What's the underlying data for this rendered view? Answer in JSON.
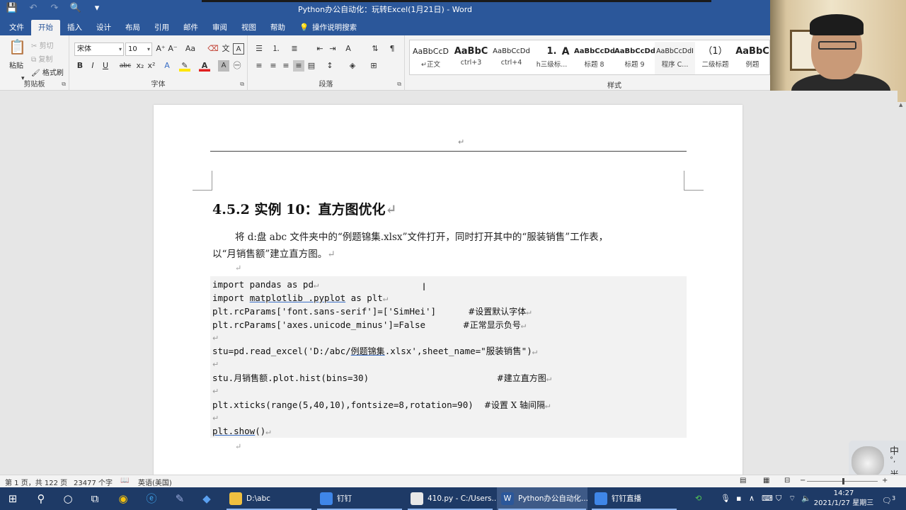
{
  "window": {
    "title": "Python办公自动化：玩转Excel(1月21日)  -  Word",
    "qat": [
      "💾",
      "↶",
      "↷",
      "🔍",
      "▾"
    ]
  },
  "tabs": [
    "文件",
    "开始",
    "插入",
    "设计",
    "布局",
    "引用",
    "邮件",
    "审阅",
    "视图",
    "帮助"
  ],
  "tell_me": "操作说明搜索",
  "ribbon": {
    "clipboard": {
      "paste": "粘贴",
      "cut": "剪切",
      "copy": "复制",
      "format_painter": "格式刷",
      "label": "剪贴板"
    },
    "font": {
      "font_name": "宋体",
      "font_size": "10",
      "label": "字体",
      "grow": "A⁺",
      "shrink": "A⁻",
      "case": "Aa",
      "bold": "B",
      "italic": "I",
      "underline": "U",
      "strike": "abc",
      "sub": "x₂",
      "sup": "x²"
    },
    "paragraph": {
      "label": "段落"
    },
    "styles": {
      "label": "样式",
      "items": [
        {
          "preview": "AaBbCcD",
          "name": "↵正文"
        },
        {
          "preview": "AaBbC",
          "name": "ctrl+3"
        },
        {
          "preview": "AaBbCcDd",
          "name": "ctrl+4"
        },
        {
          "preview": "1.",
          "name": "h三级标..."
        },
        {
          "preview": "A",
          "name": ""
        },
        {
          "preview": "AaBbCcDd",
          "name": "标题 8"
        },
        {
          "preview": "AaBbCcDd",
          "name": "标题 9"
        },
        {
          "preview": "AaBbCcDdI",
          "name": "程序  C..."
        },
        {
          "preview": "（1）",
          "name": "二级标题"
        },
        {
          "preview": "AaBbC",
          "name": "例题"
        }
      ]
    }
  },
  "document": {
    "heading": "4.5.2 实例 10：直方图优化",
    "para_line1": "将 d:盘 abc 文件夹中的“例题锦集.xlsx”文件打开，同时打开其中的“服装销售”工作表，",
    "para_line2": "以“月销售额”建立直方图。",
    "code": {
      "l1": "import pandas as pd",
      "l2a": "import ",
      "l2b": "matplotlib .pyplot",
      "l2c": " as plt",
      "l3": "plt.rcParams['font.sans-serif']=['SimHei']      ",
      "l3c": "#设置默认字体",
      "l4": "plt.rcParams['axes.unicode_minus']=False       ",
      "l4c": "#正常显示负号",
      "l5a": "stu=pd.read_excel('D:/abc/",
      "l5b": "例题锦集",
      "l5c": ".xlsx',sheet_name=\"服装销售\")",
      "l6a": "stu.",
      "l6b": "月销售额",
      "l6c": ".plot.hist(bins=30)                        ",
      "l6d": "#建立直方图",
      "l7": "plt.xticks(range(5,40,10),fontsize=8,rotation=90)  ",
      "l7c": "#设置 X 轴间隔",
      "l8a": "plt.show",
      "l8b": "()"
    },
    "return_mark": "↵"
  },
  "statusbar": {
    "page": "第 1 页，共 122 页",
    "words": "23477 个字",
    "lang": "英语(美国)"
  },
  "taskbar": {
    "apps": [
      {
        "label": "D:\\abc"
      },
      {
        "label": "钉钉"
      },
      {
        "label": "410.py - C:/Users..."
      },
      {
        "label": "Python办公自动化..."
      },
      {
        "label": "钉钉直播"
      }
    ],
    "time": "14:27",
    "date": "2021/1/27 星期三",
    "notif_count": "3"
  },
  "ime": [
    "中",
    "°,",
    "半"
  ]
}
